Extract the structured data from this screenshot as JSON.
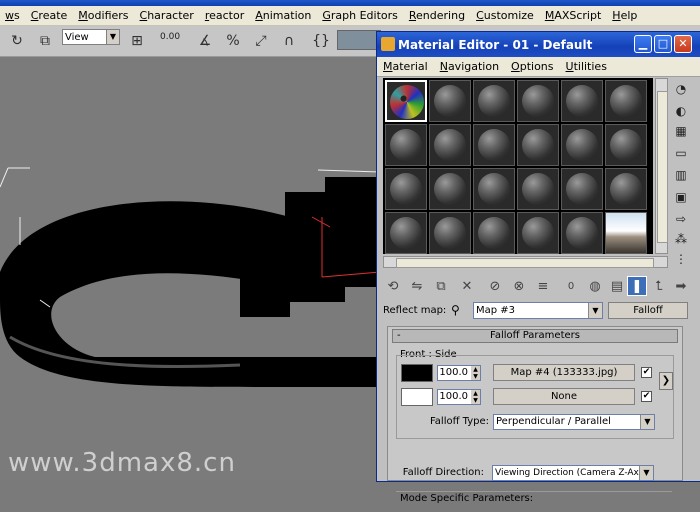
{
  "app": {
    "menu": [
      "ws",
      "Create",
      "Modifiers",
      "Character",
      "reactor",
      "Animation",
      "Graph Editors",
      "Rendering",
      "Customize",
      "MAXScript",
      "Help"
    ],
    "view_select": "View",
    "zoom_readout": "0.00",
    "watermark": "www.3dmax8.cn"
  },
  "material_editor": {
    "title": "Material Editor - 01 - Default",
    "menu": [
      "Material",
      "Navigation",
      "Options",
      "Utilities"
    ],
    "reflect_label": "Reflect map:",
    "map_name": "Map #3",
    "map_type": "Falloff",
    "slot_active_count": "0",
    "rollout": {
      "title": "Falloff Parameters",
      "collapse_symbol": "-",
      "group_label": "Front : Side",
      "row1": {
        "spin": "100.0",
        "map": "Map #4 (133333.jpg)",
        "checked": "✔",
        "color": "#000000"
      },
      "row2": {
        "spin": "100.0",
        "map": "None",
        "checked": "✔",
        "color": "#ffffff"
      },
      "falloff_type_label": "Falloff Type:",
      "falloff_type": "Perpendicular / Parallel",
      "falloff_dir_label": "Falloff Direction:",
      "falloff_dir": "Viewing Direction (Camera Z-Axis)",
      "mode_label": "Mode Specific Parameters:"
    }
  }
}
